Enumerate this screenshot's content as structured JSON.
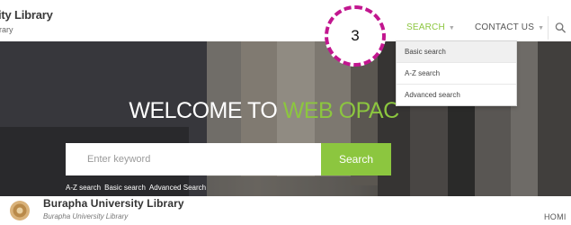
{
  "header": {
    "title": "ity Library",
    "subtitle": "rary",
    "nav": {
      "search_label": "SEARCH",
      "contact_label": "CONTACT US"
    }
  },
  "dropdown": {
    "items": [
      "Basic search",
      "A-Z search",
      "Advanced search"
    ],
    "active_index": 0
  },
  "callout": {
    "number": "3",
    "color": "#c2168f"
  },
  "hero": {
    "welcome_prefix": "WELCOME TO ",
    "welcome_highlight": "WEB OPAC",
    "search_placeholder": "Enter keyword",
    "search_button": "Search",
    "quick_links": [
      "A-Z search",
      "Basic search",
      "Advanced Search"
    ]
  },
  "footer": {
    "title": "Burapha University Library",
    "subtitle": "Burapha University Library",
    "nav_home": "HOMI"
  },
  "colors": {
    "accent": "#8cc63f",
    "text_dark": "#333333"
  },
  "icons": {
    "nav_search": "magnifier-icon",
    "chevron": "chevron-down-icon",
    "logo": "university-seal-logo"
  }
}
